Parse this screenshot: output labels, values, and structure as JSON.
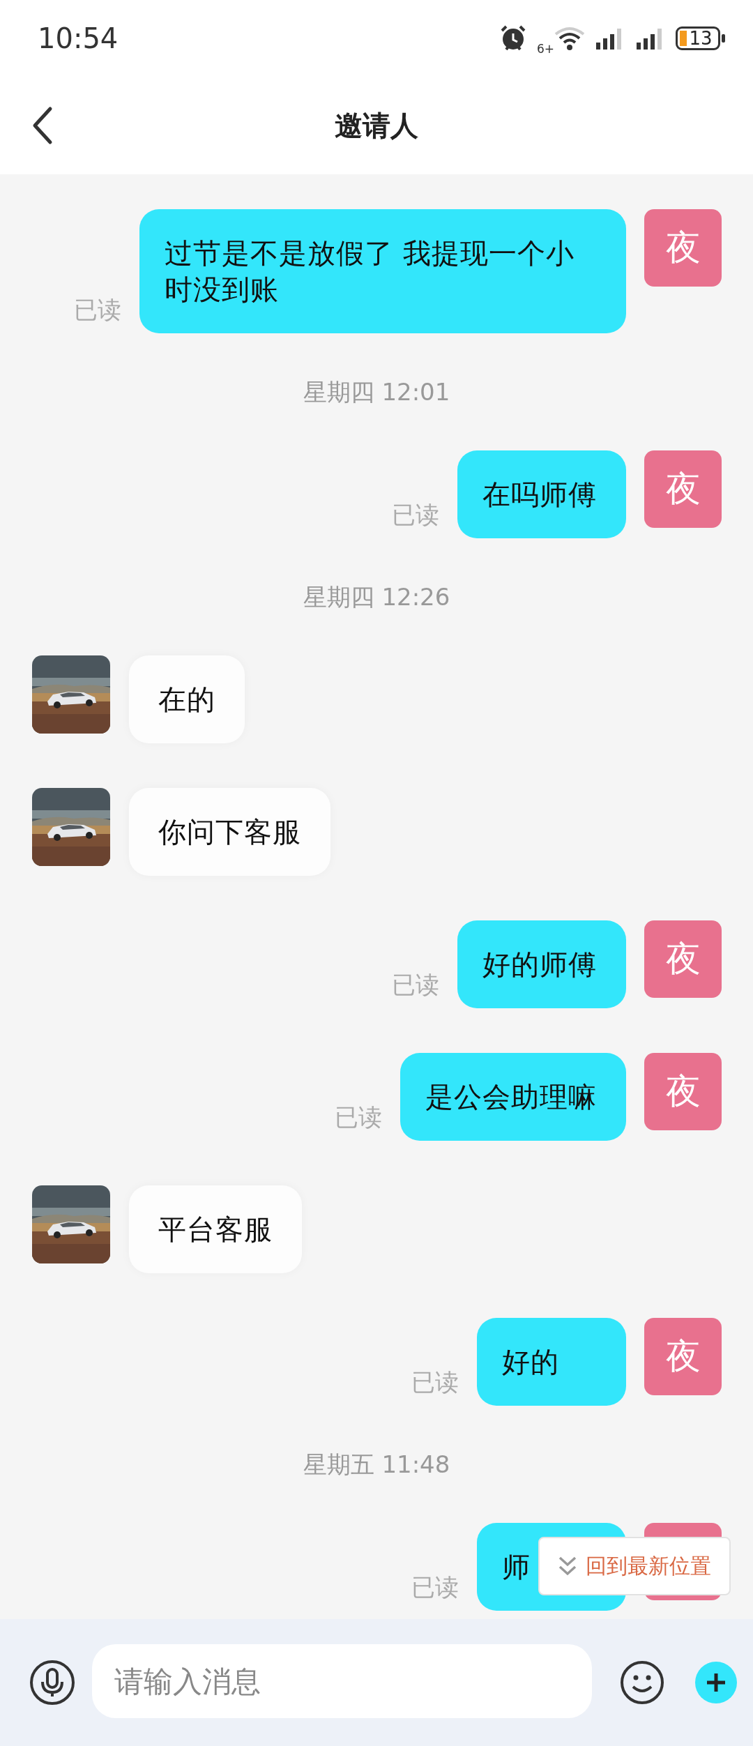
{
  "status_bar": {
    "time": "10:54",
    "network": "6+",
    "battery": "13"
  },
  "header": {
    "title": "邀请人"
  },
  "messages": [
    {
      "kind": "outgoing",
      "text": "过节是不是放假了 我提现一个小时没到账",
      "avatar": "夜",
      "receipt": "已读"
    },
    {
      "kind": "time",
      "text": "星期四 12:01"
    },
    {
      "kind": "outgoing",
      "text": "在吗师傅",
      "avatar": "夜",
      "receipt": "已读"
    },
    {
      "kind": "time",
      "text": "星期四 12:26"
    },
    {
      "kind": "incoming",
      "text": "在的"
    },
    {
      "kind": "incoming",
      "text": "你问下客服"
    },
    {
      "kind": "outgoing",
      "text": "好的师傅",
      "avatar": "夜",
      "receipt": "已读"
    },
    {
      "kind": "outgoing",
      "text": "是公会助理嘛",
      "avatar": "夜",
      "receipt": "已读"
    },
    {
      "kind": "incoming",
      "text": "平台客服"
    },
    {
      "kind": "outgoing",
      "text": "好的",
      "avatar": "夜",
      "receipt": "已读"
    },
    {
      "kind": "time",
      "text": "星期五 11:48"
    },
    {
      "kind": "outgoing",
      "text": "师",
      "receipt": "已读"
    }
  ],
  "jump_button": {
    "label": "回到最新位置"
  },
  "composer": {
    "placeholder": "请输入消息"
  }
}
